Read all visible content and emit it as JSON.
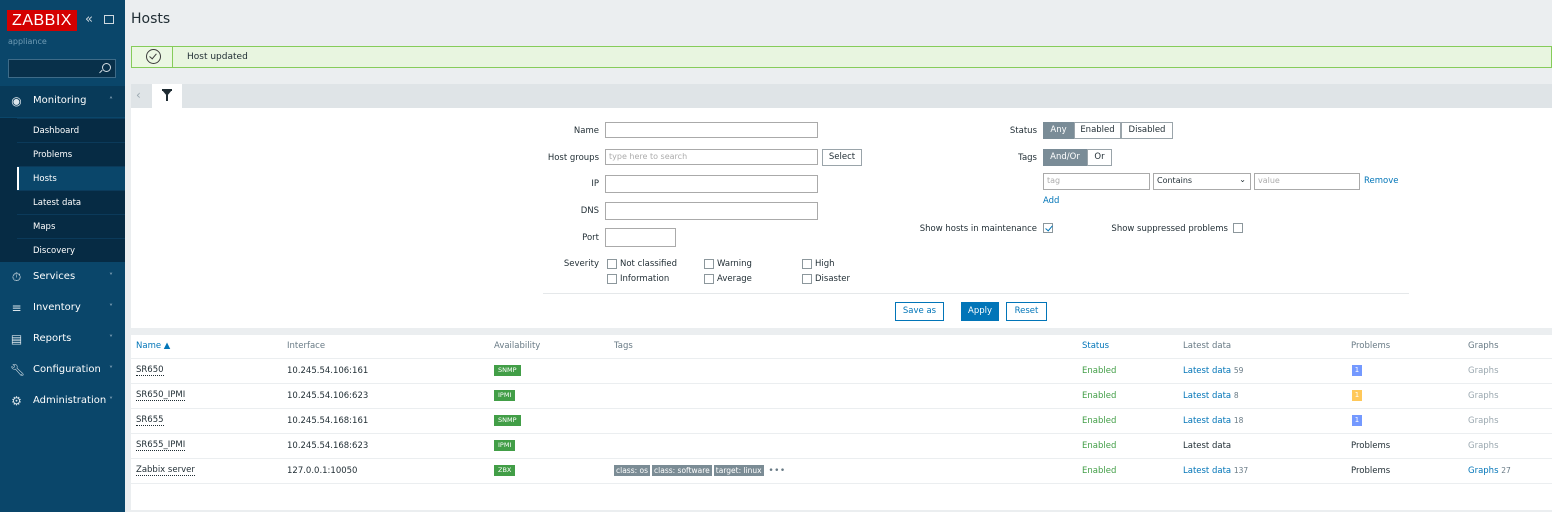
{
  "brand": {
    "logo": "ZABBIX",
    "server_name": "appliance"
  },
  "sidebar": {
    "sections": [
      {
        "label": "Monitoring",
        "icon": "eye-icon",
        "open": true
      },
      {
        "label": "Services",
        "icon": "stopwatch-icon"
      },
      {
        "label": "Inventory",
        "icon": "list-icon"
      },
      {
        "label": "Reports",
        "icon": "chart-icon"
      },
      {
        "label": "Configuration",
        "icon": "wrench-icon"
      },
      {
        "label": "Administration",
        "icon": "gear-icon"
      }
    ],
    "monitoring_items": [
      "Dashboard",
      "Problems",
      "Hosts",
      "Latest data",
      "Maps",
      "Discovery"
    ],
    "active_item": "Hosts"
  },
  "page": {
    "title": "Hosts"
  },
  "message": {
    "text": "Host updated",
    "type": "success"
  },
  "filter": {
    "name_label": "Name",
    "host_groups_label": "Host groups",
    "host_groups_placeholder": "type here to search",
    "select_label": "Select",
    "ip_label": "IP",
    "dns_label": "DNS",
    "port_label": "Port",
    "severity_label": "Severity",
    "severities": [
      "Not classified",
      "Warning",
      "High",
      "Information",
      "Average",
      "Disaster"
    ],
    "status_label": "Status",
    "status_options": [
      "Any",
      "Enabled",
      "Disabled"
    ],
    "status_selected": "Any",
    "tags_label": "Tags",
    "tags_options": [
      "And/Or",
      "Or"
    ],
    "tags_selected": "And/Or",
    "tag_placeholder": "tag",
    "tag_operator": "Contains",
    "value_placeholder": "value",
    "remove_label": "Remove",
    "add_label": "Add",
    "show_maintenance_label": "Show hosts in maintenance",
    "show_maintenance_checked": true,
    "show_suppressed_label": "Show suppressed problems",
    "show_suppressed_checked": false,
    "save_as_label": "Save as",
    "apply_label": "Apply",
    "reset_label": "Reset"
  },
  "table": {
    "columns": [
      "Name ▲",
      "Interface",
      "Availability",
      "Tags",
      "Status",
      "Latest data",
      "Problems",
      "Graphs"
    ],
    "rows": [
      {
        "name": "SR650",
        "interface": "10.245.54.106:161",
        "availability": "SNMP",
        "tags": [],
        "status": "Enabled",
        "latest": "Latest data",
        "latest_count": "59",
        "problems": "1",
        "problem_color": "#7499ff",
        "graphs": "Graphs",
        "graphs_count": ""
      },
      {
        "name": "SR650_IPMI",
        "interface": "10.245.54.106:623",
        "availability": "IPMI",
        "tags": [],
        "status": "Enabled",
        "latest": "Latest data",
        "latest_count": "8",
        "problems": "1",
        "problem_color": "#ffc859",
        "graphs": "Graphs",
        "graphs_count": ""
      },
      {
        "name": "SR655",
        "interface": "10.245.54.168:161",
        "availability": "SNMP",
        "tags": [],
        "status": "Enabled",
        "latest": "Latest data",
        "latest_count": "18",
        "problems": "1",
        "problem_color": "#7499ff",
        "graphs": "Graphs",
        "graphs_count": ""
      },
      {
        "name": "SR655_IPMI",
        "interface": "10.245.54.168:623",
        "availability": "IPMI",
        "tags": [],
        "status": "Enabled",
        "latest": "Latest data",
        "latest_count": "",
        "problems": "Problems",
        "problem_color": "",
        "graphs": "Graphs",
        "graphs_count": ""
      },
      {
        "name": "Zabbix server",
        "interface": "127.0.0.1:10050",
        "availability": "ZBX",
        "tags": [
          "class: os",
          "class: software",
          "target: linux"
        ],
        "status": "Enabled",
        "latest": "Latest data",
        "latest_count": "137",
        "problems": "Problems",
        "problem_color": "",
        "graphs": "Graphs",
        "graphs_count": "27"
      }
    ]
  },
  "colors": {
    "sidebar": "#0a466a",
    "logo": "#d40000",
    "link": "#0275b8",
    "enabled": "#429e47"
  }
}
